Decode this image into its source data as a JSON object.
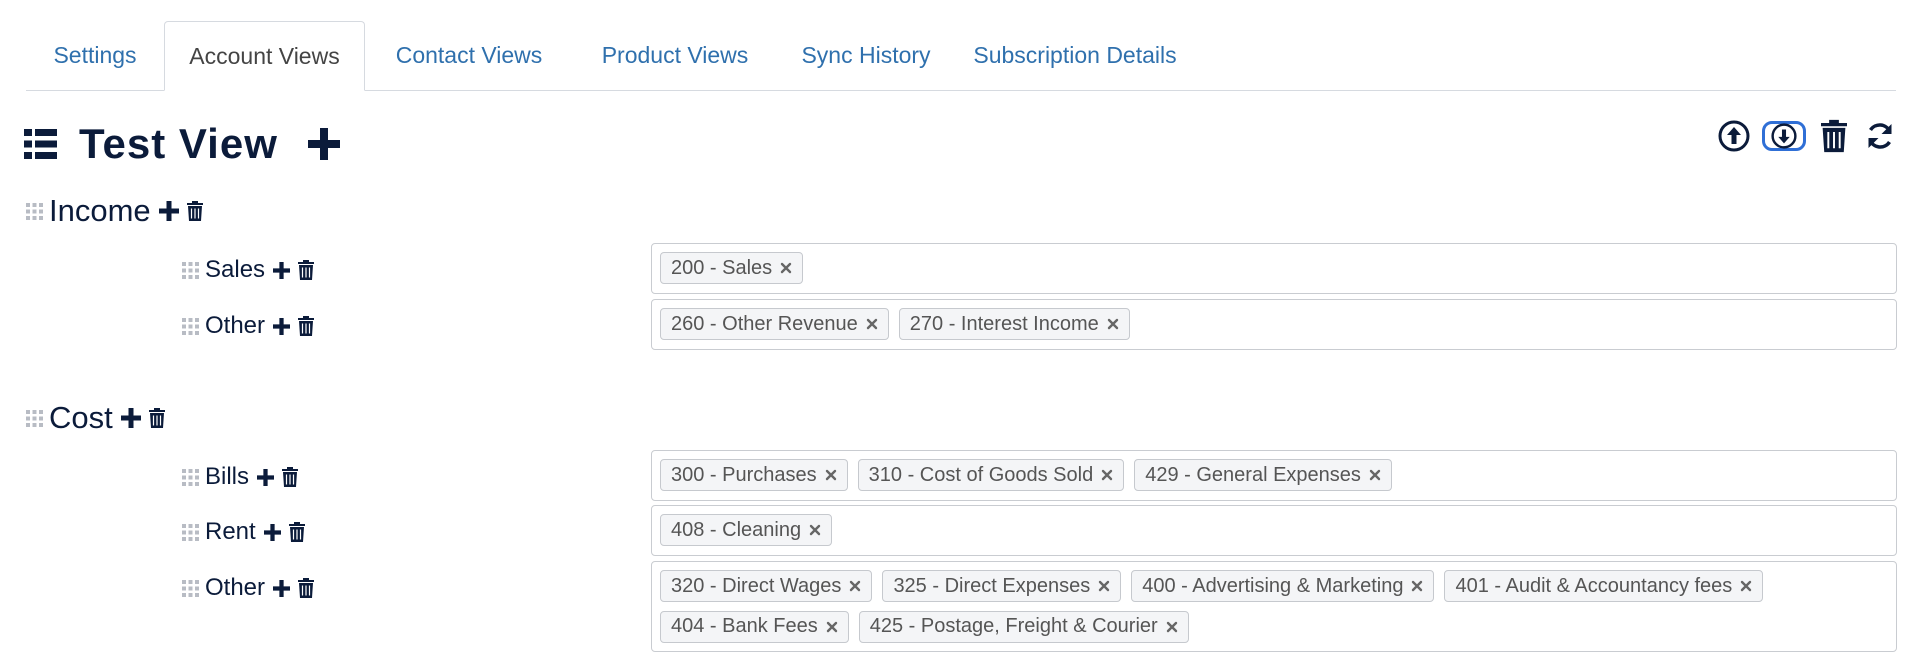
{
  "tabs": [
    {
      "label": "Settings",
      "active": false
    },
    {
      "label": "Account Views",
      "active": true
    },
    {
      "label": "Contact Views",
      "active": false
    },
    {
      "label": "Product Views",
      "active": false
    },
    {
      "label": "Sync History",
      "active": false
    },
    {
      "label": "Subscription Details",
      "active": false
    }
  ],
  "view": {
    "title": "Test View",
    "icons": [
      "list-icon",
      "plus-icon"
    ]
  },
  "toolbar": {
    "icons": [
      "upload-circle-icon",
      "download-circle-icon",
      "trash-icon",
      "refresh-icon"
    ]
  },
  "colors": {
    "tab_link": "#2f70ad",
    "text_dark": "#0b1b3a",
    "focus_outline": "#2f6fd6",
    "tag_bg": "#f4f5f7"
  },
  "groups": [
    {
      "name": "Income",
      "subgroups": [
        {
          "name": "Sales",
          "accounts": [
            "200 - Sales"
          ]
        },
        {
          "name": "Other",
          "accounts": [
            "260 - Other Revenue",
            "270 - Interest Income"
          ]
        }
      ]
    },
    {
      "name": "Cost",
      "subgroups": [
        {
          "name": "Bills",
          "accounts": [
            "300 - Purchases",
            "310 - Cost of Goods Sold",
            "429 - General Expenses"
          ]
        },
        {
          "name": "Rent",
          "accounts": [
            "408 - Cleaning"
          ]
        },
        {
          "name": "Other",
          "accounts": [
            "320 - Direct Wages",
            "325 - Direct Expenses",
            "400 - Advertising & Marketing",
            "401 - Audit & Accountancy fees",
            "404 - Bank Fees",
            "425 - Postage, Freight & Courier"
          ]
        }
      ]
    }
  ]
}
